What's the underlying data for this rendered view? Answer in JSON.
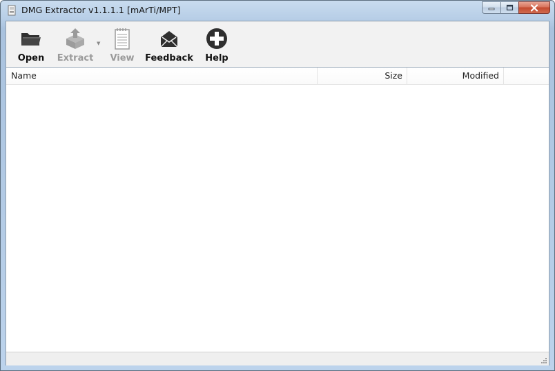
{
  "window": {
    "title": "DMG Extractor v1.1.1.1 [mArTi/MPT]"
  },
  "toolbar": {
    "buttons": [
      {
        "label": "Open",
        "icon": "folder-icon",
        "enabled": true
      },
      {
        "label": "Extract",
        "icon": "extract-icon",
        "enabled": false
      },
      {
        "label": "View",
        "icon": "notepad-icon",
        "enabled": false
      },
      {
        "label": "Feedback",
        "icon": "envelope-icon",
        "enabled": true
      },
      {
        "label": "Help",
        "icon": "plus-circle-icon",
        "enabled": true
      }
    ]
  },
  "filelist": {
    "columns": [
      "Name",
      "Size",
      "Modified"
    ],
    "rows": []
  },
  "colors": {
    "titlebar": "#b6cde6",
    "toolbar": "#f2f2f2",
    "close_button": "#c34a2f",
    "disabled_text": "#9a9a9a"
  }
}
